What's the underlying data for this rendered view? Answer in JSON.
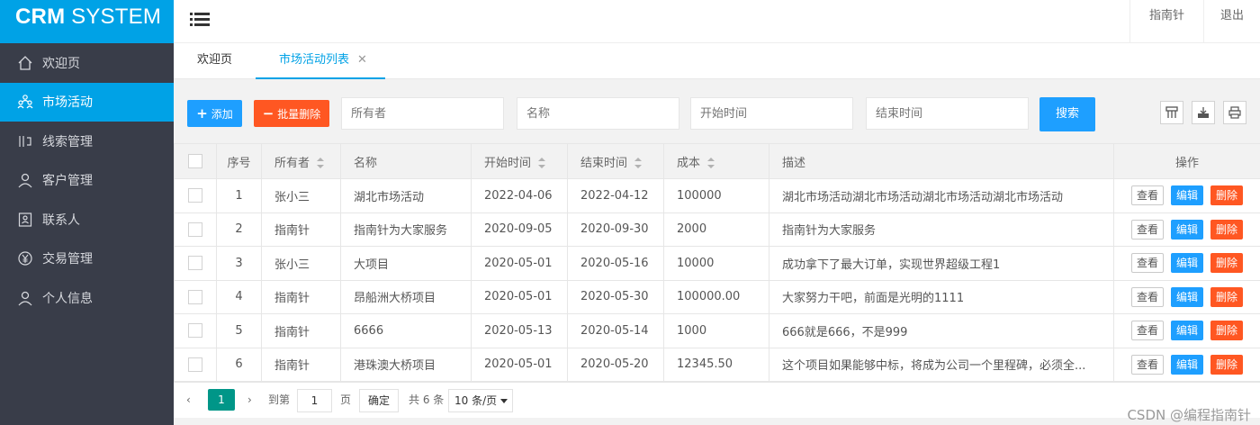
{
  "logo": {
    "strong": "CRM",
    "light": " SYSTEM"
  },
  "sidebar": {
    "items": [
      {
        "label": "欢迎页",
        "icon": "home-icon",
        "active": false
      },
      {
        "label": "市场活动",
        "icon": "people-group-icon",
        "active": true
      },
      {
        "label": "线索管理",
        "icon": "clue-icon",
        "active": false
      },
      {
        "label": "客户管理",
        "icon": "user-icon",
        "active": false
      },
      {
        "label": "联系人",
        "icon": "contact-card-icon",
        "active": false
      },
      {
        "label": "交易管理",
        "icon": "rmb-icon",
        "active": false
      },
      {
        "label": "个人信息",
        "icon": "person-icon",
        "active": false
      }
    ]
  },
  "header": {
    "user": "指南针",
    "logout": "退出"
  },
  "tabs": [
    {
      "label": "欢迎页",
      "active": false
    },
    {
      "label": "市场活动列表",
      "active": true,
      "close": "✕"
    }
  ],
  "toolbar": {
    "add_label": "添加",
    "batch_delete_label": "批量删除",
    "search_label": "搜索",
    "placeholders": {
      "owner": "所有者",
      "name": "名称",
      "start": "开始时间",
      "end": "结束时间"
    }
  },
  "table": {
    "headers": {
      "index": "序号",
      "owner": "所有者",
      "name": "名称",
      "start": "开始时间",
      "end": "结束时间",
      "cost": "成本",
      "desc": "描述",
      "ops": "操作"
    },
    "ops": {
      "view": "查看",
      "edit": "编辑",
      "delete": "删除"
    },
    "rows": [
      {
        "index": "1",
        "owner": "张小三",
        "name": "湖北市场活动",
        "start": "2022-04-06",
        "end": "2022-04-12",
        "cost": "100000",
        "desc": "湖北市场活动湖北市场活动湖北市场活动湖北市场活动"
      },
      {
        "index": "2",
        "owner": "指南针",
        "name": "指南针为大家服务",
        "start": "2020-09-05",
        "end": "2020-09-30",
        "cost": "2000",
        "desc": "指南针为大家服务"
      },
      {
        "index": "3",
        "owner": "张小三",
        "name": "大项目",
        "start": "2020-05-01",
        "end": "2020-05-16",
        "cost": "10000",
        "desc": "成功拿下了最大订单，实现世界超级工程1"
      },
      {
        "index": "4",
        "owner": "指南针",
        "name": "昂船洲大桥项目",
        "start": "2020-05-01",
        "end": "2020-05-30",
        "cost": "100000.00",
        "desc": "大家努力干吧，前面是光明的1111"
      },
      {
        "index": "5",
        "owner": "指南针",
        "name": "6666",
        "start": "2020-05-13",
        "end": "2020-05-14",
        "cost": "1000",
        "desc": "666就是666，不是999"
      },
      {
        "index": "6",
        "owner": "指南针",
        "name": "港珠澳大桥项目",
        "start": "2020-05-01",
        "end": "2020-05-20",
        "cost": "12345.50",
        "desc": "这个项目如果能够中标，将成为公司一个里程碑，必须全..."
      }
    ]
  },
  "pager": {
    "prev": "‹",
    "current": "1",
    "next": "›",
    "goto_label": "到第",
    "page_input": "1",
    "page_unit": "页",
    "confirm": "确定",
    "total": "共 6 条",
    "page_size": "10 条/页"
  },
  "watermark": "CSDN @编程指南针",
  "colors": {
    "primary": "#00a2e6",
    "sidebar_bg": "#393d49",
    "btn_blue": "#1e9fff",
    "btn_red": "#ff5722",
    "pager_current": "#009688"
  }
}
